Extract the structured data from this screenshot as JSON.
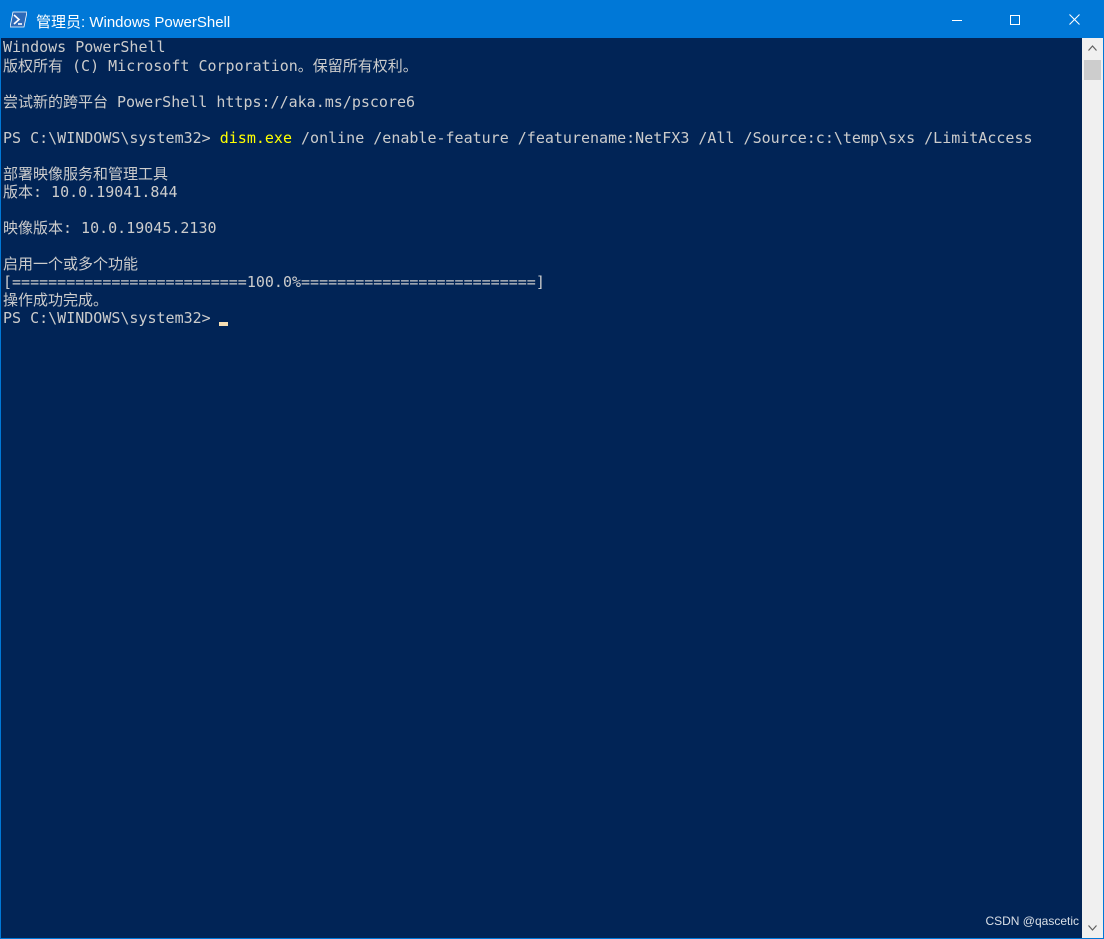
{
  "window": {
    "title": "管理员: Windows PowerShell",
    "accent_color": "#0078d7",
    "console_bg": "#012456",
    "icons": {
      "app": "powershell-icon",
      "minimize": "minimize-icon",
      "maximize": "maximize-icon",
      "close": "close-icon"
    }
  },
  "console": {
    "lines": [
      "Windows PowerShell",
      "版权所有 (C) Microsoft Corporation。保留所有权利。",
      "",
      "尝试新的跨平台 PowerShell https://aka.ms/pscore6",
      "",
      "PS C:\\WINDOWS\\system32> ",
      "",
      "部署映像服务和管理工具",
      "版本: 10.0.19041.844",
      "",
      "映像版本: 10.0.19045.2130",
      "",
      "启用一个或多个功能",
      "[==========================100.0%==========================]",
      "操作成功完成。",
      "PS C:\\WINDOWS\\system32> "
    ],
    "command": {
      "prompt": "PS C:\\WINDOWS\\system32> ",
      "exe": "dism.exe",
      "args": " /online /enable-feature /featurename:NetFX3 /All /Source:c:\\temp\\sxs /LimitAccess"
    },
    "progress_percent": 100.0,
    "text_color": "#cccccc",
    "command_color": "#ffff00"
  },
  "watermark": "CSDN @qascetic"
}
